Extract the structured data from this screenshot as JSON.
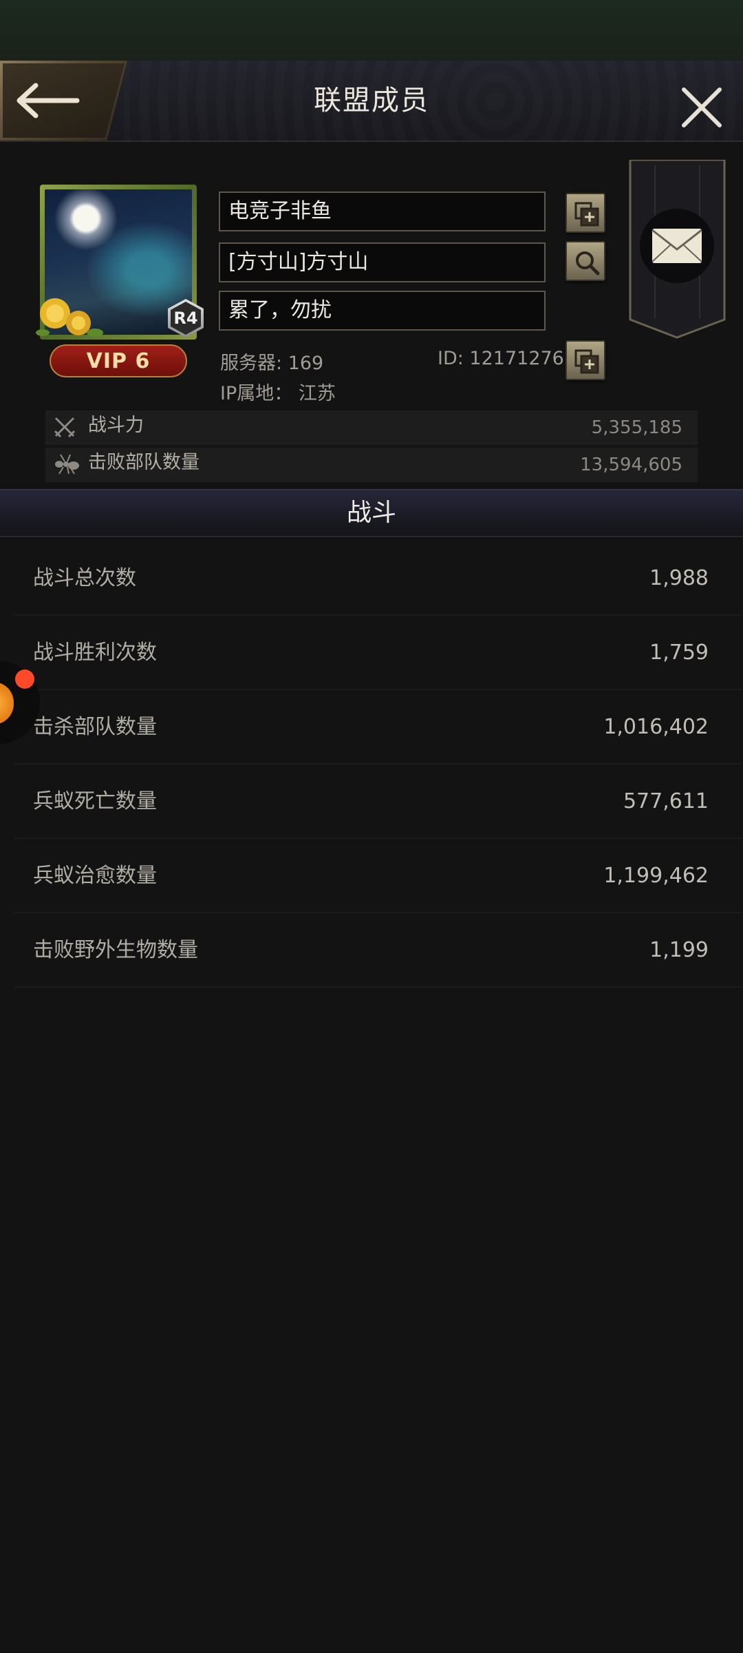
{
  "header": {
    "title": "联盟成员"
  },
  "profile": {
    "name": "电竞子非鱼",
    "alliance": "[方寸山]方寸山",
    "signature": "累了，勿扰",
    "rank": "R4",
    "vip": "VIP 6",
    "server": "服务器: 169",
    "id": "ID: 12171276",
    "ip_location": "IP属地：  江苏"
  },
  "stats": [
    {
      "label": "战斗力",
      "value": "5,355,185",
      "icon": "crossed-swords-icon"
    },
    {
      "label": "击败部队数量",
      "value": "13,594,605",
      "icon": "ant-icon"
    }
  ],
  "section": {
    "title": "战斗"
  },
  "battle": [
    {
      "label": "战斗总次数",
      "value": "1,988"
    },
    {
      "label": "战斗胜利次数",
      "value": "1,759"
    },
    {
      "label": "击杀部队数量",
      "value": "1,016,402"
    },
    {
      "label": "兵蚁死亡数量",
      "value": "577,611"
    },
    {
      "label": "兵蚁治愈数量",
      "value": "1,199,462"
    },
    {
      "label": "击败野外生物数量",
      "value": "1,199"
    }
  ],
  "colors": {
    "background": "#131313",
    "gold_accent": "#b0a584",
    "vip_red": "#a11f18"
  }
}
